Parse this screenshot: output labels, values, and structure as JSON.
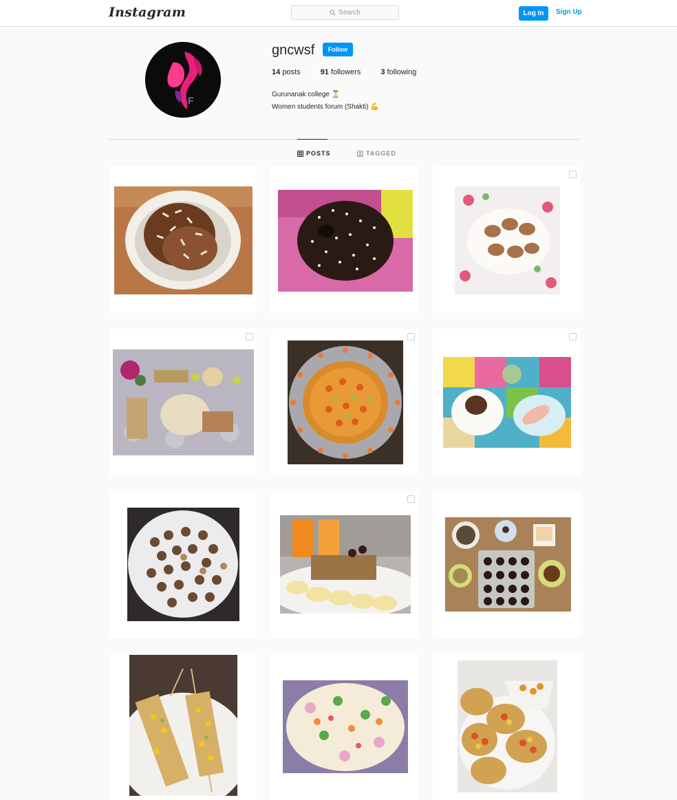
{
  "app": {
    "logo_text": "Instagram"
  },
  "nav": {
    "search_placeholder": "Search",
    "login_label": "Log In",
    "signup_label": "Sign Up"
  },
  "profile": {
    "username": "gncwsf",
    "follow_label": "Follow",
    "posts_count": "14",
    "posts_label": "posts",
    "followers_count": "91",
    "followers_label": "followers",
    "following_count": "3",
    "following_label": "following",
    "bio_line1": "Gurunanak college ⏳",
    "bio_line2": "Women students forum (Shakti) 💪"
  },
  "tabs": [
    {
      "label": "POSTS",
      "icon": "grid-icon",
      "active": true
    },
    {
      "label": "TAGGED",
      "icon": "tagged-icon",
      "active": false
    }
  ],
  "posts": [
    {
      "subject": "ice cream with almonds",
      "multi": false
    },
    {
      "subject": "chocolate cake",
      "multi": false
    },
    {
      "subject": "cutlets on plate",
      "multi": true
    },
    {
      "subject": "food platter",
      "multi": true
    },
    {
      "subject": "vegetable jelly dish",
      "multi": true
    },
    {
      "subject": "dessert plates",
      "multi": true
    },
    {
      "subject": "laddoos on plate",
      "multi": false
    },
    {
      "subject": "cake with banana",
      "multi": true
    },
    {
      "subject": "chocolate balls tray",
      "multi": false
    },
    {
      "subject": "skewers",
      "multi": false
    },
    {
      "subject": "salad",
      "multi": false
    },
    {
      "subject": "papad chaat",
      "multi": false
    }
  ],
  "colors": {
    "accent": "#0095f6",
    "background": "#fafafa",
    "border": "#dbdbdb",
    "text": "#262626",
    "muted": "#8e8e8e"
  }
}
